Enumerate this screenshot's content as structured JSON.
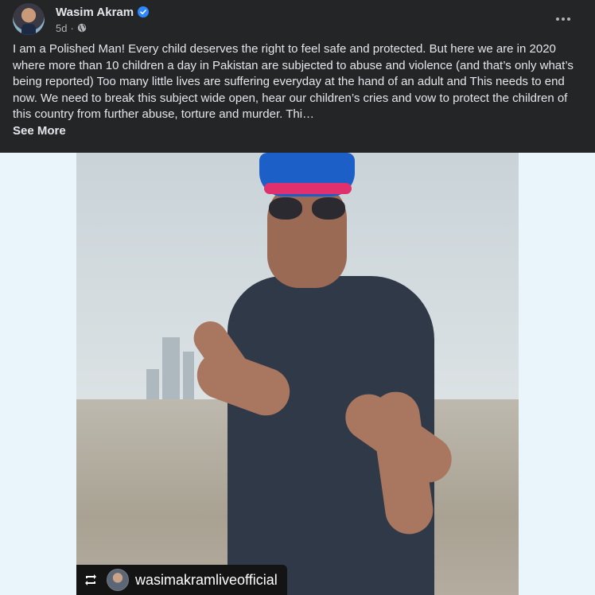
{
  "post": {
    "author": "Wasim Akram",
    "time": "5d",
    "separator": "·",
    "visibility_icon": "globe-icon",
    "verified_icon": "verified-badge-icon",
    "more_icon": "more-options-icon",
    "text": "I am a Polished Man! Every child deserves the right to feel safe and protected. But here we are in 2020 where more than 10 children a day in Pakistan are subjected to abuse and violence (and that’s only what’s being reported) Too many little lives are suffering everyday at the hand of an adult and This needs to end now. We need to break this subject wide open, hear our children’s cries and vow to protect the children of this country from further abuse, torture and murder. Thi…",
    "see_more": "See More"
  },
  "photo": {
    "repost_icon": "repost-icon",
    "handle": "wasimakramliveofficial"
  },
  "colors": {
    "background": "#242526",
    "text": "#e4e6eb",
    "secondary": "#b0b3b8",
    "verified": "#2d88ff",
    "photo_border": "#e9f4fb"
  }
}
